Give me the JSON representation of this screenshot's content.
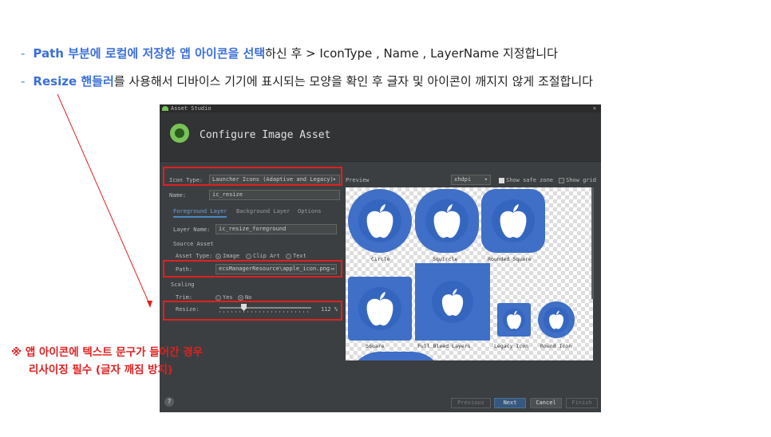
{
  "slide": {
    "bullet1": {
      "dash": "-",
      "hl": "Path 부분에 로컬에 저장한 앱 아이콘을 선택",
      "rest": "하신 후 > IconType , Name , LayerName 지정합니다"
    },
    "bullet2": {
      "dash": "-",
      "hl": "Resize 핸들러",
      "rest": "를 사용해서 디바이스 기기에 표시되는 모양을 확인 후 글자 및 아이콘이 깨지지 않게 조절합니다"
    },
    "note_line1": "※ 앱 아이콘에 텍스트 문구가 들어간 경우",
    "note_line2": "리사이징 필수 (글자 깨짐 방지)"
  },
  "dialog": {
    "window_title": "Asset Studio",
    "close": "×",
    "header_title": "Configure Image Asset",
    "icon_type_label": "Icon Type:",
    "icon_type_value": "Launcher Icons (Adaptive and Legacy)",
    "name_label": "Name:",
    "name_value": "ic_resize",
    "tabs": [
      "Foreground Layer",
      "Background Layer",
      "Options"
    ],
    "layer_name_label": "Layer Name:",
    "layer_name_value": "ic_resize_foreground",
    "source_asset_label": "Source Asset",
    "asset_type_label": "Asset Type:",
    "asset_types": [
      "Image",
      "Clip Art",
      "Text"
    ],
    "asset_type_selected": "Image",
    "path_label": "Path:",
    "path_value": "ecsManagerResource\\apple_icon.png",
    "scaling_label": "Scaling",
    "trim_label": "Trim:",
    "trim_options": [
      "Yes",
      "No"
    ],
    "trim_selected": "No",
    "resize_label": "Resize:",
    "resize_value": "112 %",
    "resize_percent": 112,
    "preview_label": "Preview",
    "density": "xhdpi",
    "show_safe_zone": "Show safe zone",
    "show_grid": "Show grid",
    "preview_captions": [
      "Circle",
      "Squircle",
      "Rounded Square",
      "Square",
      "Full Bleed Layers",
      "Legacy Icon",
      "Round Icon"
    ],
    "buttons": {
      "help": "?",
      "previous": "Previous",
      "next": "Next",
      "cancel": "Cancel",
      "finish": "Finish"
    }
  },
  "colors": {
    "accent_blue": "#3b6fd8",
    "red": "#e02020",
    "icon_blue": "#3f6fc6"
  }
}
